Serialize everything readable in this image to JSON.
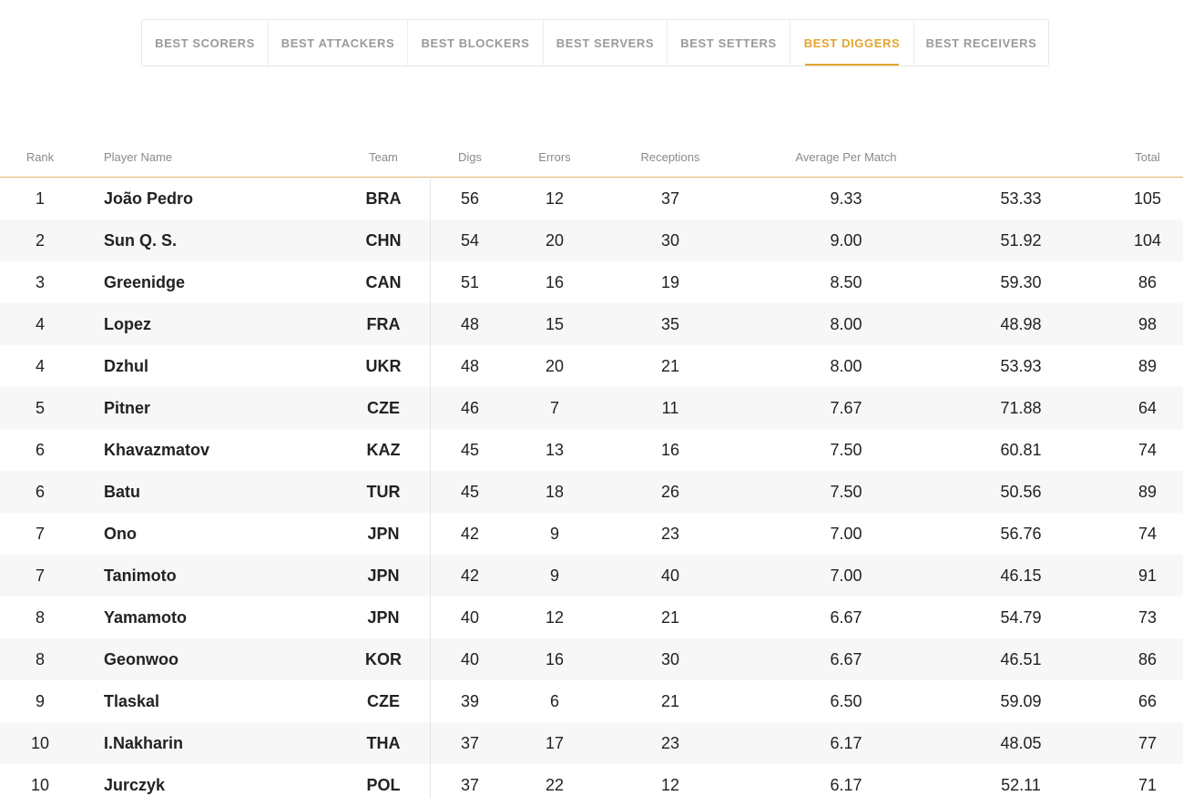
{
  "tabs": [
    {
      "label": "BEST SCORERS",
      "active": false
    },
    {
      "label": "BEST ATTACKERS",
      "active": false
    },
    {
      "label": "BEST BLOCKERS",
      "active": false
    },
    {
      "label": "BEST SERVERS",
      "active": false
    },
    {
      "label": "BEST SETTERS",
      "active": false
    },
    {
      "label": "BEST DIGGERS",
      "active": true
    },
    {
      "label": "BEST RECEIVERS",
      "active": false
    }
  ],
  "colors": {
    "accent": "#e3a52e"
  },
  "table": {
    "headers": {
      "rank": "Rank",
      "player": "Player Name",
      "team": "Team",
      "digs": "Digs",
      "errors": "Errors",
      "receptions": "Receptions",
      "average": "Average Per Match",
      "total": "Total"
    },
    "rows": [
      {
        "rank": "1",
        "name": "João Pedro",
        "team": "BRA",
        "digs": "56",
        "errors": "12",
        "receptions": "37",
        "average": "9.33",
        "pct": "53.33",
        "total": "105"
      },
      {
        "rank": "2",
        "name": "Sun Q. S.",
        "team": "CHN",
        "digs": "54",
        "errors": "20",
        "receptions": "30",
        "average": "9.00",
        "pct": "51.92",
        "total": "104"
      },
      {
        "rank": "3",
        "name": "Greenidge",
        "team": "CAN",
        "digs": "51",
        "errors": "16",
        "receptions": "19",
        "average": "8.50",
        "pct": "59.30",
        "total": "86"
      },
      {
        "rank": "4",
        "name": "Lopez",
        "team": "FRA",
        "digs": "48",
        "errors": "15",
        "receptions": "35",
        "average": "8.00",
        "pct": "48.98",
        "total": "98"
      },
      {
        "rank": "4",
        "name": "Dzhul",
        "team": "UKR",
        "digs": "48",
        "errors": "20",
        "receptions": "21",
        "average": "8.00",
        "pct": "53.93",
        "total": "89"
      },
      {
        "rank": "5",
        "name": "Pitner",
        "team": "CZE",
        "digs": "46",
        "errors": "7",
        "receptions": "11",
        "average": "7.67",
        "pct": "71.88",
        "total": "64"
      },
      {
        "rank": "6",
        "name": "Khavazmatov",
        "team": "KAZ",
        "digs": "45",
        "errors": "13",
        "receptions": "16",
        "average": "7.50",
        "pct": "60.81",
        "total": "74"
      },
      {
        "rank": "6",
        "name": "Batu",
        "team": "TUR",
        "digs": "45",
        "errors": "18",
        "receptions": "26",
        "average": "7.50",
        "pct": "50.56",
        "total": "89"
      },
      {
        "rank": "7",
        "name": "Ono",
        "team": "JPN",
        "digs": "42",
        "errors": "9",
        "receptions": "23",
        "average": "7.00",
        "pct": "56.76",
        "total": "74"
      },
      {
        "rank": "7",
        "name": "Tanimoto",
        "team": "JPN",
        "digs": "42",
        "errors": "9",
        "receptions": "40",
        "average": "7.00",
        "pct": "46.15",
        "total": "91"
      },
      {
        "rank": "8",
        "name": "Yamamoto",
        "team": "JPN",
        "digs": "40",
        "errors": "12",
        "receptions": "21",
        "average": "6.67",
        "pct": "54.79",
        "total": "73"
      },
      {
        "rank": "8",
        "name": "Geonwoo",
        "team": "KOR",
        "digs": "40",
        "errors": "16",
        "receptions": "30",
        "average": "6.67",
        "pct": "46.51",
        "total": "86"
      },
      {
        "rank": "9",
        "name": "Tlaskal",
        "team": "CZE",
        "digs": "39",
        "errors": "6",
        "receptions": "21",
        "average": "6.50",
        "pct": "59.09",
        "total": "66"
      },
      {
        "rank": "10",
        "name": "I.Nakharin",
        "team": "THA",
        "digs": "37",
        "errors": "17",
        "receptions": "23",
        "average": "6.17",
        "pct": "48.05",
        "total": "77"
      },
      {
        "rank": "10",
        "name": "Jurczyk",
        "team": "POL",
        "digs": "37",
        "errors": "22",
        "receptions": "12",
        "average": "6.17",
        "pct": "52.11",
        "total": "71"
      }
    ]
  }
}
